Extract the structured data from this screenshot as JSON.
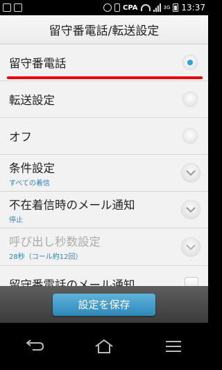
{
  "status_bar": {
    "carrier": "CPA",
    "network": "3G",
    "time": "13:37"
  },
  "title": "留守番電話/転送設定",
  "options": [
    {
      "label": "留守番電話",
      "control": "radio",
      "selected": true
    },
    {
      "label": "転送設定",
      "control": "radio",
      "selected": false
    },
    {
      "label": "オフ",
      "control": "radio",
      "selected": false
    }
  ],
  "settings": [
    {
      "label": "条件設定",
      "sub": "すべての着信",
      "control": "chevron",
      "enabled": true
    },
    {
      "label": "不在着信時のメール通知",
      "sub": "停止",
      "control": "chevron",
      "enabled": true
    },
    {
      "label": "呼び出し秒数設定",
      "sub": "28秒（コール約12回）",
      "control": "chevron",
      "enabled": false
    },
    {
      "label": "留守番電話のメール通知",
      "control": "checkbox",
      "checked": false
    }
  ],
  "save_button": "設定を保存",
  "nav": {
    "back": "back-icon",
    "home": "home-icon",
    "menu": "menu-icon"
  },
  "colors": {
    "accent": "#2fa2d6",
    "highlight": "#e8000b"
  }
}
